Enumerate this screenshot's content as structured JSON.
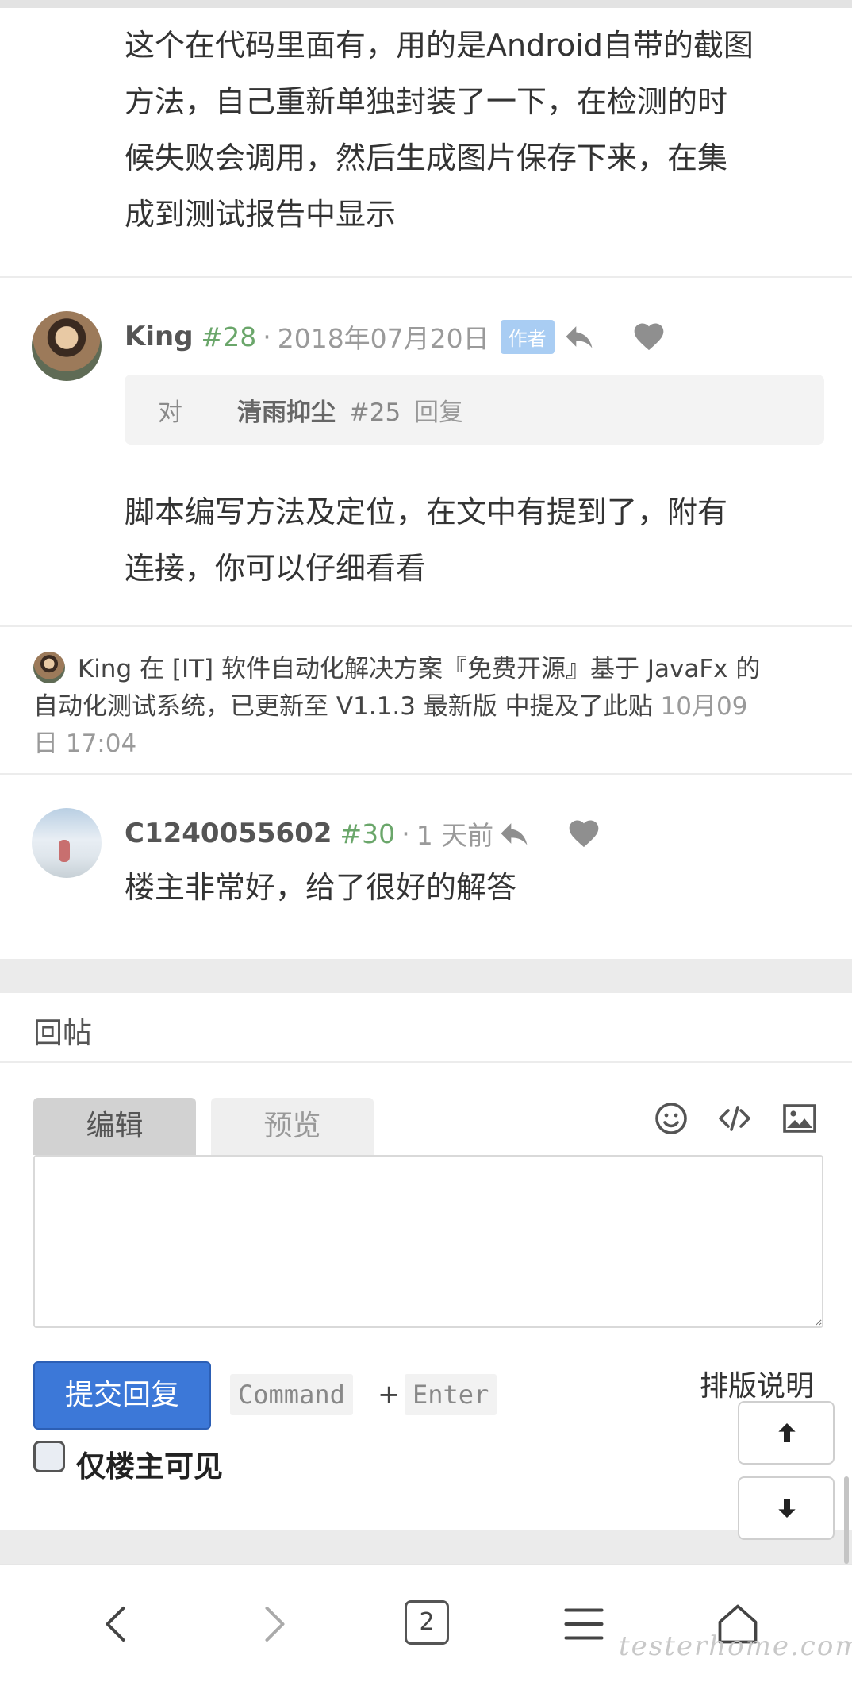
{
  "comments": {
    "prev_post": {
      "lines": [
        "这个在代码里面有，用的是Android自带的截图",
        "方法，自己重新单独封装了一下，在检测的时",
        "候失败会调用，然后生成图片保存下来，在集",
        "成到测试报告中显示"
      ]
    },
    "post28": {
      "username": "King",
      "floor": "#28",
      "separator": "·",
      "date": "2018年07月20日",
      "badge": "作者",
      "reply_to": {
        "prefix": "对",
        "name": "清雨抑尘",
        "floor": "#25",
        "suffix": "回复"
      },
      "lines": [
        "脚本编写方法及定位，在文中有提到了，附有",
        "连接，你可以仔细看看"
      ]
    },
    "mention": {
      "user": "King",
      "word_in": "在",
      "topic_line1": "[IT] 软件自动化解决方案『免费开源』基于 JavaFx 的",
      "topic_line2": "自动化测试系统，已更新至 V1.1.3 最新版",
      "action": "中提及了此贴",
      "time_part1": "10月09",
      "time_part2": "日 17:04"
    },
    "post30": {
      "username": "C1240055602",
      "floor": "#30",
      "separator": "·",
      "date": "1 天前",
      "text": "楼主非常好，给了很好的解答"
    }
  },
  "reply_panel": {
    "title": "回帖",
    "tabs": [
      "编辑",
      "预览"
    ],
    "tool_icons": [
      "smile-icon",
      "code-icon",
      "image-icon"
    ],
    "editor_value": "",
    "submit_label": "提交回复",
    "shortcut": {
      "key1": "Command",
      "plus": "+",
      "key2": "Enter"
    },
    "help_label": "排版说明",
    "checkbox_label": "仅楼主可见",
    "checkbox_checked": false
  },
  "bottom_bar": {
    "tab_count": "2",
    "watermark": "testerhome.com",
    "icons": [
      "back-icon",
      "forward-icon",
      "tabs-icon",
      "menu-icon",
      "home-icon"
    ]
  },
  "colors": {
    "floor": "#6aa66a",
    "badge": "#a9cdf3",
    "submit": "#3c78d8"
  }
}
